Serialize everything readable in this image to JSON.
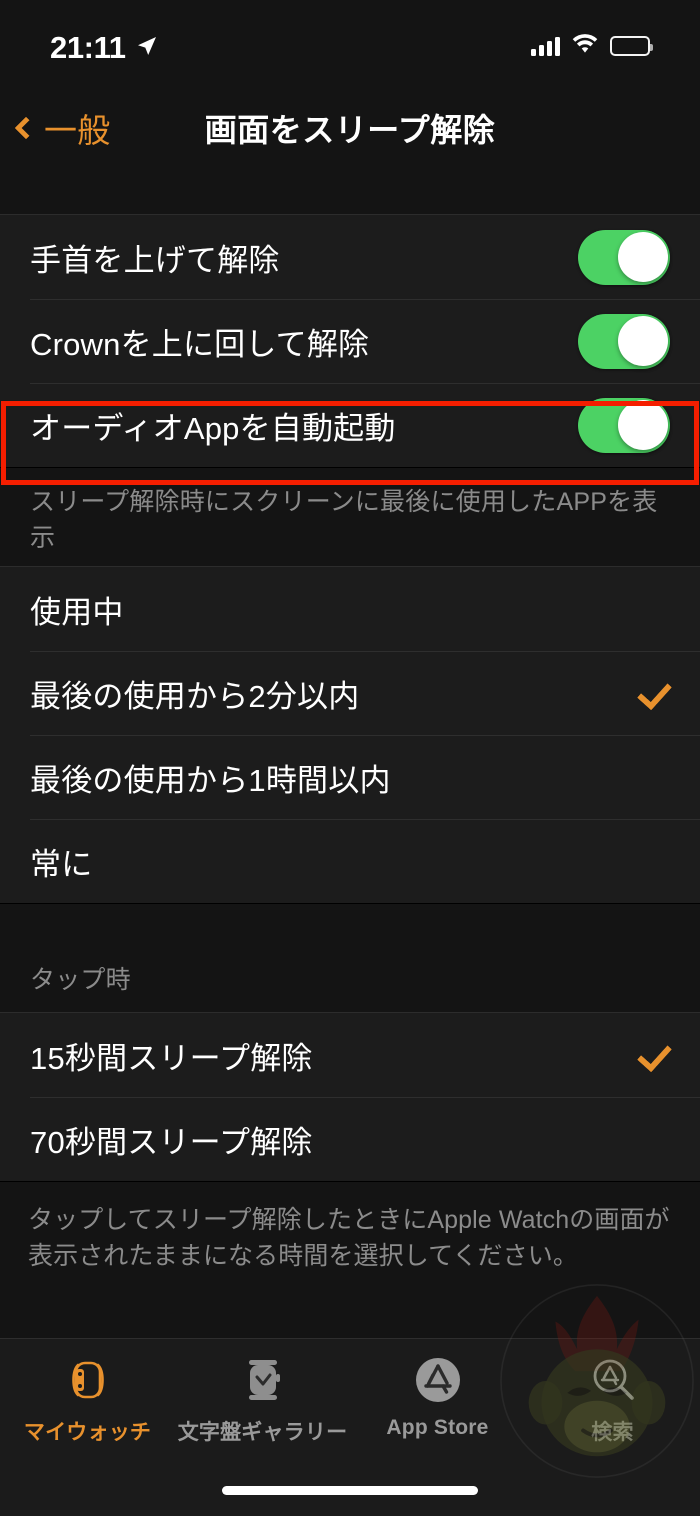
{
  "status_bar": {
    "time": "21:11",
    "location_icon": "location-arrow-icon",
    "signal_icon": "cellular-signal-icon",
    "wifi_icon": "wifi-icon",
    "battery_icon": "battery-icon"
  },
  "nav": {
    "back_label": "一般",
    "back_icon": "chevron-left-icon",
    "title": "画面をスリープ解除"
  },
  "toggles_group": {
    "rows": [
      {
        "label": "手首を上げて解除",
        "value": "on"
      },
      {
        "label": "Crownを上に回して解除",
        "value": "on"
      },
      {
        "label": "オーディオAppを自動起動",
        "value": "on",
        "highlighted": true
      }
    ]
  },
  "wake_group": {
    "header": "スリープ解除時にスクリーンに最後に使用したAPPを表示",
    "options": [
      {
        "label": "使用中",
        "checked": false
      },
      {
        "label": "最後の使用から2分以内",
        "checked": true
      },
      {
        "label": "最後の使用から1時間以内",
        "checked": false
      },
      {
        "label": "常に",
        "checked": false
      }
    ]
  },
  "tap_group": {
    "header": "タップ時",
    "options": [
      {
        "label": "15秒間スリープ解除",
        "checked": true
      },
      {
        "label": "70秒間スリープ解除",
        "checked": false
      }
    ],
    "footer": "タップしてスリープ解除したときにApple Watchの画面が表示されたままになる時間を選択してください。"
  },
  "tab_bar": {
    "tabs": [
      {
        "label": "マイウォッチ",
        "icon": "apple-watch-icon",
        "active": true
      },
      {
        "label": "文字盤ギャラリー",
        "icon": "watch-face-icon",
        "active": false
      },
      {
        "label": "App Store",
        "icon": "app-store-icon",
        "active": false
      },
      {
        "label": "検索",
        "icon": "search-app-store-icon",
        "active": false
      }
    ]
  },
  "colors": {
    "accent": "#E8912D",
    "toggle_on": "#4CD264",
    "highlight": "#F51E00",
    "background": "#141414",
    "row_background": "#1C1C1C",
    "secondary_text": "#8B8B8B"
  }
}
